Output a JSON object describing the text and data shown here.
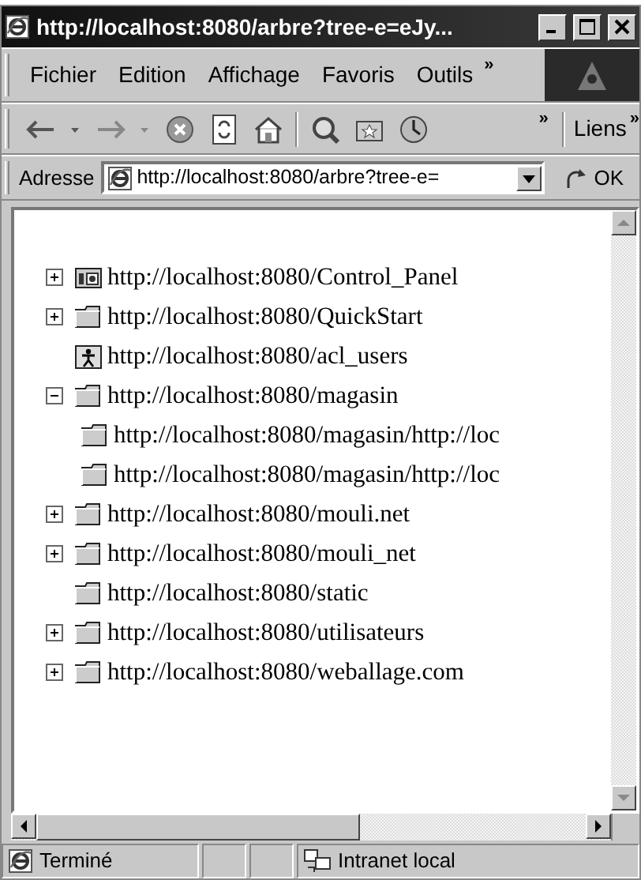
{
  "window": {
    "title": "http://localhost:8080/arbre?tree-e=eJy..."
  },
  "menu": [
    {
      "label": "Fichier"
    },
    {
      "label": "Edition"
    },
    {
      "label": "Affichage"
    },
    {
      "label": "Favoris"
    },
    {
      "label": "Outils"
    }
  ],
  "menu_more": "»",
  "toolbar_more": "»",
  "links": {
    "label": "Liens",
    "more": "»"
  },
  "address": {
    "label": "Adresse",
    "value": "http://localhost:8080/arbre?tree-e=",
    "go": "OK"
  },
  "tree": [
    {
      "label": "http://localhost:8080/Control_Panel",
      "kind": "panel",
      "expanded": false
    },
    {
      "label": "http://localhost:8080/QuickStart",
      "kind": "folder",
      "expanded": false
    },
    {
      "label": "http://localhost:8080/acl_users",
      "kind": "users"
    },
    {
      "label": "http://localhost:8080/magasin",
      "kind": "folder",
      "expanded": true,
      "children": [
        {
          "label": "http://localhost:8080/magasin/http://loc",
          "kind": "folder"
        },
        {
          "label": "http://localhost:8080/magasin/http://loc",
          "kind": "folder"
        }
      ]
    },
    {
      "label": "http://localhost:8080/mouli.net",
      "kind": "folder",
      "expanded": false
    },
    {
      "label": "http://localhost:8080/mouli_net",
      "kind": "folder",
      "expanded": false
    },
    {
      "label": "http://localhost:8080/static",
      "kind": "folder"
    },
    {
      "label": "http://localhost:8080/utilisateurs",
      "kind": "folder",
      "expanded": false
    },
    {
      "label": "http://localhost:8080/weballage.com",
      "kind": "folder",
      "expanded": false
    }
  ],
  "status_bar": {
    "text": "Terminé",
    "zone": "Intranet local"
  }
}
